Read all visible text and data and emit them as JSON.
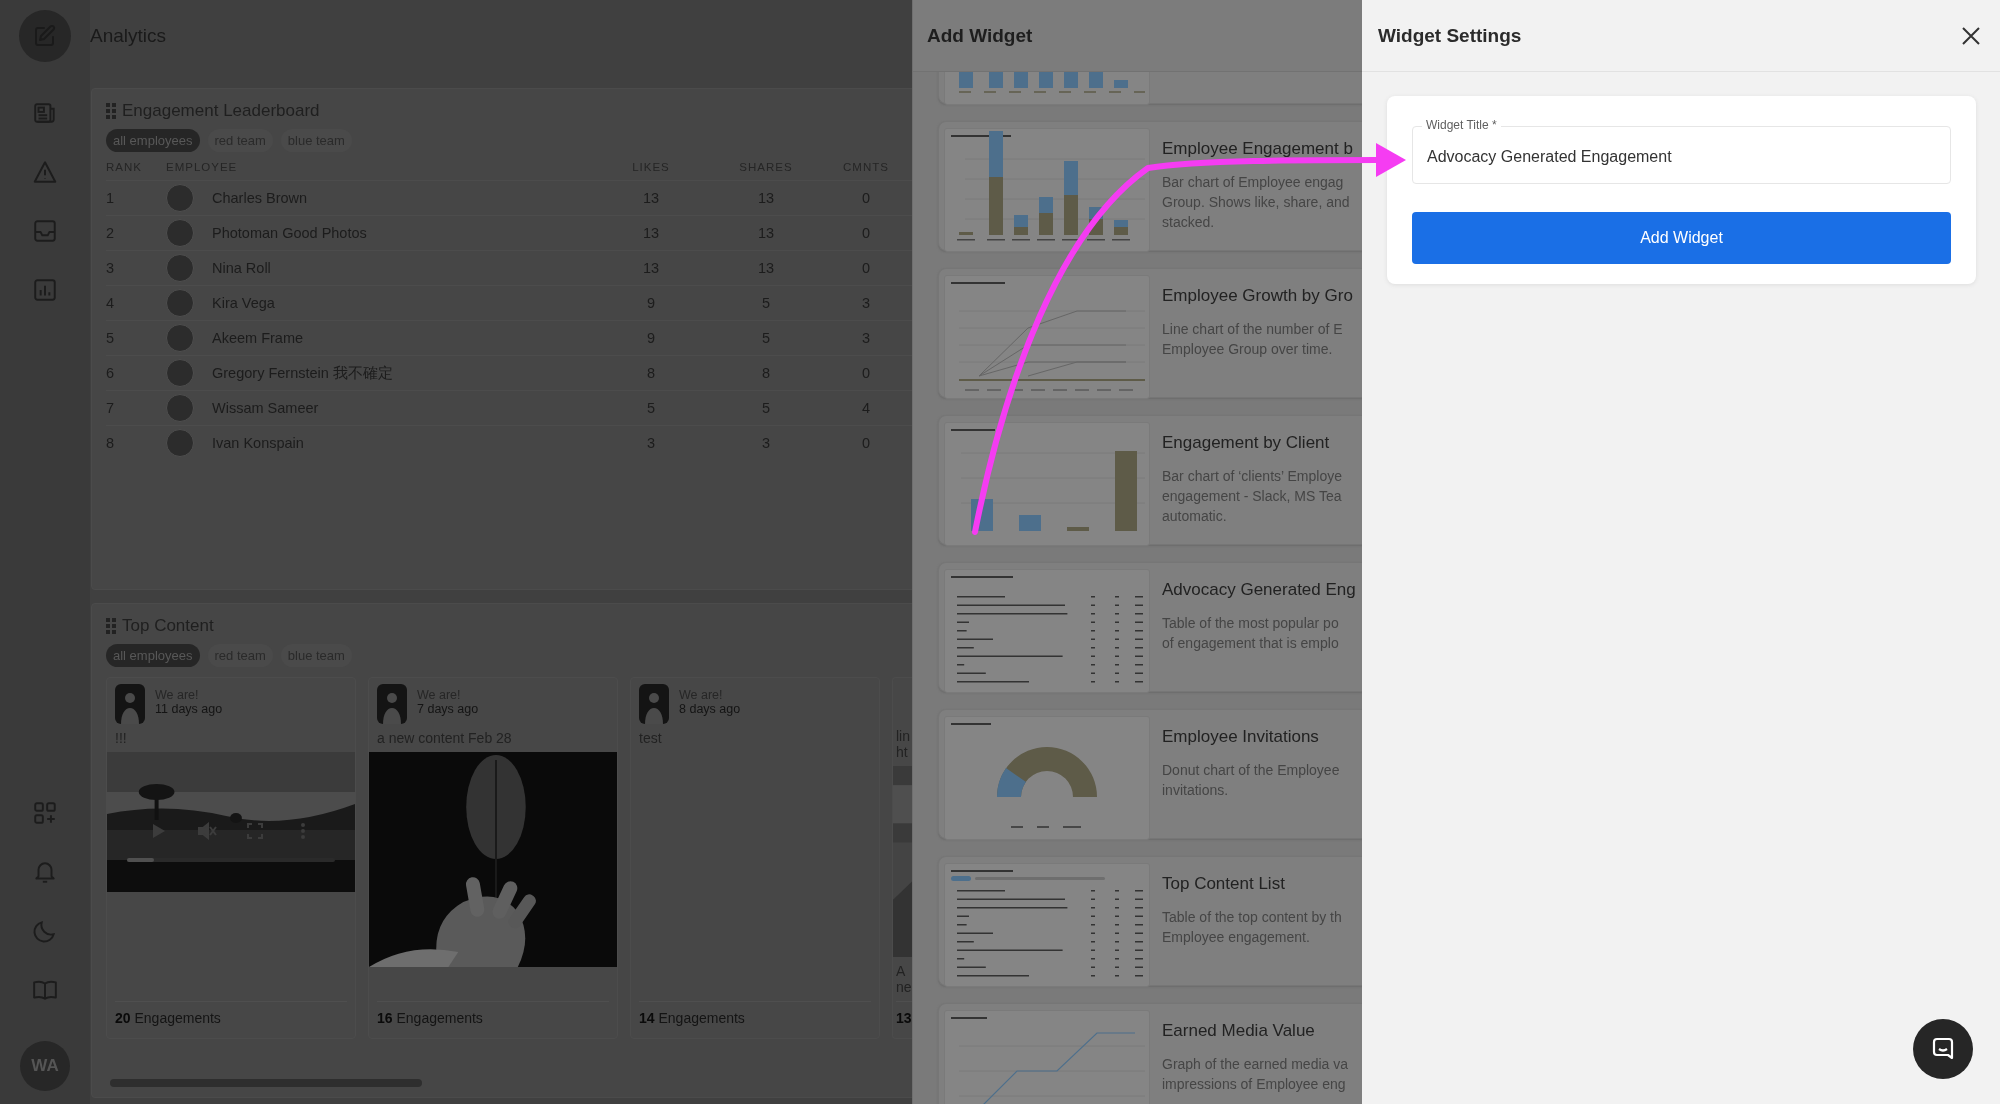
{
  "sidebar": {
    "avatar_initials": "WA"
  },
  "header": {
    "title": "Analytics"
  },
  "leaderboard": {
    "title": "Engagement Leaderboard",
    "filters": [
      {
        "label": "all employees",
        "selected": true
      },
      {
        "label": "red team",
        "selected": false
      },
      {
        "label": "blue team",
        "selected": false
      }
    ],
    "columns": [
      "RANK",
      "EMPLOYEE",
      "LIKES",
      "SHARES",
      "CMNTS"
    ],
    "rows": [
      {
        "rank": "1",
        "employee": "Charles Brown",
        "likes": "13",
        "shares": "13",
        "comments": "0"
      },
      {
        "rank": "2",
        "employee": "Photoman Good Photos",
        "likes": "13",
        "shares": "13",
        "comments": "0"
      },
      {
        "rank": "3",
        "employee": "Nina Roll",
        "likes": "13",
        "shares": "13",
        "comments": "0"
      },
      {
        "rank": "4",
        "employee": "Kira Vega",
        "likes": "9",
        "shares": "5",
        "comments": "3"
      },
      {
        "rank": "5",
        "employee": "Akeem Frame",
        "likes": "9",
        "shares": "5",
        "comments": "3"
      },
      {
        "rank": "6",
        "employee": "Gregory Fernstein 我不確定",
        "likes": "8",
        "shares": "8",
        "comments": "0"
      },
      {
        "rank": "7",
        "employee": "Wissam Sameer",
        "likes": "5",
        "shares": "5",
        "comments": "4"
      },
      {
        "rank": "8",
        "employee": "Ivan Konspain",
        "likes": "3",
        "shares": "3",
        "comments": "0"
      }
    ]
  },
  "top_content": {
    "title": "Top Content",
    "filters": [
      {
        "label": "all employees",
        "selected": true
      },
      {
        "label": "red team",
        "selected": false
      },
      {
        "label": "blue team",
        "selected": false
      }
    ],
    "posts": [
      {
        "kind": "full",
        "author": "We are!",
        "time": "11 days ago",
        "text_lines": [
          "!!!"
        ],
        "media": {
          "kind": "video",
          "progress": {
            "level": 0.13
          }
        },
        "engagement_count": "20",
        "engagement_label": "Engagements"
      },
      {
        "kind": "full",
        "author": "We are!",
        "time": "7 days ago",
        "text_lines": [
          "a new content Feb 28"
        ],
        "media": {
          "kind": "picture"
        },
        "engagement_count": "16",
        "engagement_label": "Engagements"
      },
      {
        "kind": "full",
        "author": "We are!",
        "time": "8 days ago",
        "text_lines": [
          "test"
        ],
        "engagement_count": "14",
        "engagement_label": "Engagements"
      },
      {
        "kind": "partial",
        "text_lines": [
          "lin",
          "ht"
        ],
        "media": {
          "kind": "picture"
        },
        "caption_lines": [
          "A",
          "ne"
        ],
        "engagement_count": "13"
      }
    ]
  },
  "add_widget": {
    "title": "Add Widget",
    "widgets": [
      {
        "kind": "bar-tall"
      },
      {
        "kind": "stacked-bar",
        "title": "Employee Engagement b",
        "description_lines": [
          "Bar chart of Employee engag",
          "Group. Shows like, share, and",
          "stacked."
        ]
      },
      {
        "kind": "multi-line",
        "title": "Employee Growth by Gro",
        "description_lines": [
          "Line chart of the number of E",
          "Employee Group over time."
        ]
      },
      {
        "kind": "bar",
        "title": "Engagement by Client",
        "description_lines": [
          "Bar chart of ‘clients’ Employe",
          "engagement - Slack, MS Tea",
          "automatic."
        ]
      },
      {
        "kind": "table",
        "title": "Advocacy Generated Eng",
        "description_lines": [
          "Table of the most popular po",
          "of engagement that is emplo"
        ]
      },
      {
        "kind": "donut",
        "title": "Employee Invitations",
        "description_lines": [
          "Donut chart of the Employee",
          "invitations."
        ]
      },
      {
        "kind": "table-tabs",
        "title": "Top Content List",
        "description_lines": [
          "Table of the top content by th",
          "Employee engagement."
        ]
      },
      {
        "kind": "line",
        "title": "Earned Media Value",
        "description_lines": [
          "Graph of the earned media va",
          "impressions of Employee eng"
        ]
      }
    ]
  },
  "widget_settings": {
    "title": "Widget Settings",
    "field": {
      "label": "Widget Title *",
      "value": "Advocacy Generated Engagement"
    },
    "submit_label": "Add Widget"
  }
}
